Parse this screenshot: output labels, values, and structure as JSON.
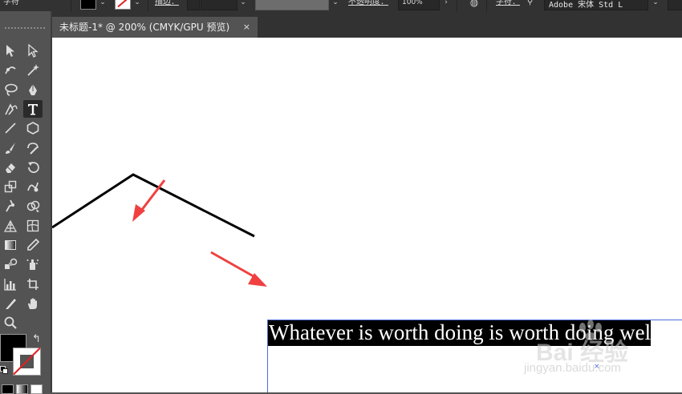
{
  "control_bar": {
    "character_label": "字符",
    "stroke_label": "描边：",
    "opacity_label": "不透明度：",
    "opacity_value": "100%",
    "char_panel_label": "字符：",
    "font_family": "Adobe 宋体 Std L",
    "fill_color": "#000000",
    "stroke_color": "none"
  },
  "document_tab": {
    "title": "未标题-1* @ 200% (CMYK/GPU 预览)",
    "close_glyph": "×"
  },
  "toolbar": {
    "tools": [
      "selection-tool",
      "direct-selection-tool",
      "curvature-tool",
      "magic-wand-tool",
      "lasso-tool",
      "pen-tool",
      "anchor-point-tool",
      "type-tool",
      "line-segment-tool",
      "polygon-tool",
      "paintbrush-tool",
      "shaper-tool",
      "eraser-tool",
      "rotate-tool",
      "scale-tool",
      "warp-tool",
      "puppet-warp-tool",
      "shape-builder-tool",
      "perspective-grid-tool",
      "mesh-tool",
      "gradient-tool",
      "eyedropper-tool",
      "blend-tool",
      "symbol-sprayer-tool",
      "column-graph-tool",
      "artboard-tool",
      "slice-tool",
      "hand-tool",
      "zoom-tool"
    ],
    "active_tool": "type-tool"
  },
  "canvas": {
    "text_content": "Whatever is worth doing is worth doing wel",
    "watermark_main": "Bai 经验",
    "watermark_sub": "jingyan.baidu.com",
    "arrow_color": "#f04040",
    "path_color": "#000000"
  }
}
